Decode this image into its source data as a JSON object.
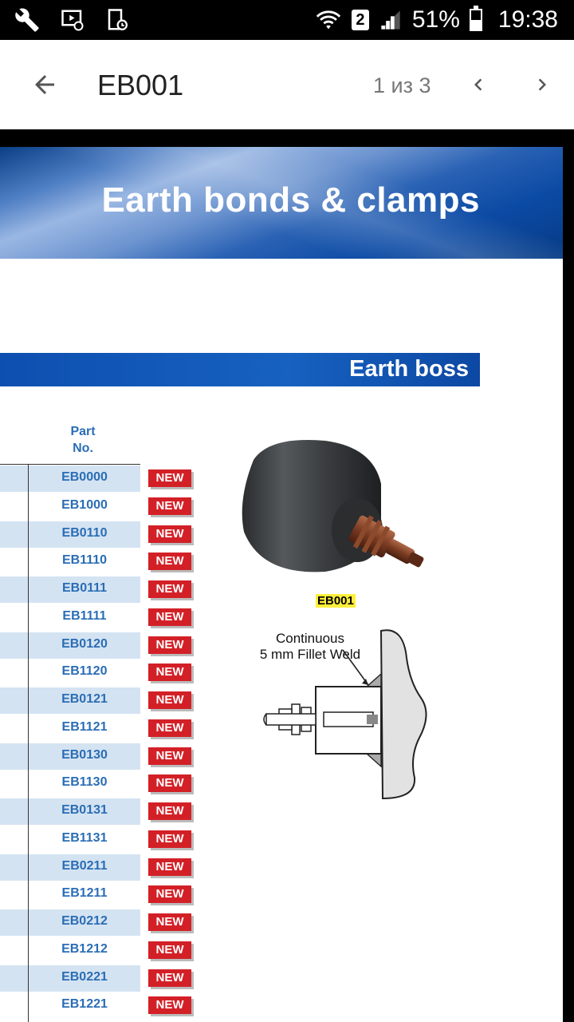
{
  "status_bar": {
    "time": "19:38",
    "battery_percent": "51%",
    "sim_slot": "2",
    "battery_level": 0.51,
    "icons": [
      "wrench-icon",
      "media-icon",
      "device-icon",
      "wifi-icon",
      "signal-icon",
      "battery-icon"
    ]
  },
  "app_bar": {
    "title": "EB001",
    "page_counter": "1 из 3"
  },
  "document": {
    "banner_title": "Earth bonds & clamps",
    "section_title": "Earth boss",
    "part_header_line1": "Part",
    "part_header_line2": "No.",
    "new_label": "NEW",
    "parts": [
      "EB0000",
      "EB1000",
      "EB0110",
      "EB1110",
      "EB0111",
      "EB1111",
      "EB0120",
      "EB1120",
      "EB0121",
      "EB1121",
      "EB0130",
      "EB1130",
      "EB0131",
      "EB1131",
      "EB0211",
      "EB1211",
      "EB0212",
      "EB1212",
      "EB0221",
      "EB1221"
    ],
    "image_caption": "EB001",
    "diagram_label_line1": "Continuous",
    "diagram_label_line2": "5 mm Fillet Weld"
  },
  "colors": {
    "accent_blue": "#2a6db5",
    "new_red": "#d32027",
    "row_stripe": "#d4e3f2",
    "caption_highlight": "#ffef3a"
  }
}
